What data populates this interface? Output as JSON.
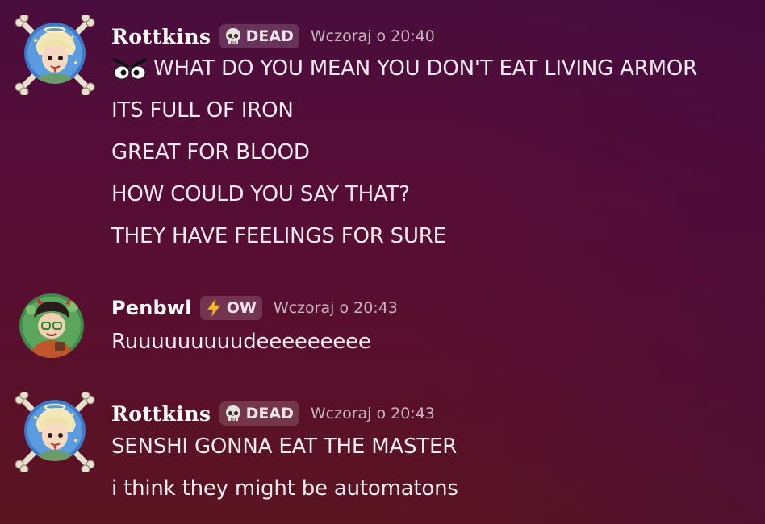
{
  "messages": [
    {
      "username": "Rottkins",
      "tag_label": "DEAD",
      "tag_icon": "skull-icon",
      "timestamp": "Wczoraj o 20:40",
      "lines": [
        "WHAT DO YOU MEAN YOU DON'T EAT LIVING ARMOR",
        "ITS FULL OF IRON",
        "GREAT FOR BLOOD",
        "HOW COULD YOU SAY THAT?",
        "THEY HAVE FEELINGS FOR SURE"
      ],
      "first_line_emoji": "angry-eyes-emoji"
    },
    {
      "username": "Penbwl",
      "tag_label": "OW",
      "tag_icon": "lightning-icon",
      "timestamp": "Wczoraj o 20:43",
      "lines": [
        "Ruuuuuuuuudeeeeeeeee"
      ]
    },
    {
      "username": "Rottkins",
      "tag_label": "DEAD",
      "tag_icon": "skull-icon",
      "timestamp": "Wczoraj o 20:43",
      "lines": [
        "SENSHI GONNA EAT THE MASTER",
        "i think they might be automatons"
      ]
    }
  ],
  "colors": {
    "background_top": "#490d3c",
    "background_bottom": "#5a1420",
    "text": "#f4ebf0",
    "timestamp": "#c9b4c2",
    "tag_bg": "rgba(255,255,255,0.16)"
  }
}
